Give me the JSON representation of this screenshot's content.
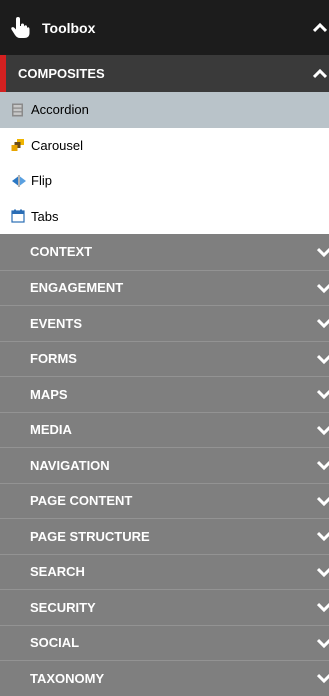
{
  "header": {
    "title": "Toolbox",
    "icon": "hand-pointer-icon"
  },
  "open_section": {
    "label": "COMPOSITES",
    "items": [
      {
        "label": "Accordion",
        "icon": "accordion-icon",
        "selected": true
      },
      {
        "label": "Carousel",
        "icon": "carousel-icon",
        "selected": false
      },
      {
        "label": "Flip",
        "icon": "flip-icon",
        "selected": false
      },
      {
        "label": "Tabs",
        "icon": "tabs-icon",
        "selected": false
      }
    ]
  },
  "sections": [
    {
      "label": "CONTEXT"
    },
    {
      "label": "ENGAGEMENT"
    },
    {
      "label": "EVENTS"
    },
    {
      "label": "FORMS"
    },
    {
      "label": "MAPS"
    },
    {
      "label": "MEDIA"
    },
    {
      "label": "NAVIGATION"
    },
    {
      "label": "PAGE CONTENT"
    },
    {
      "label": "PAGE STRUCTURE"
    },
    {
      "label": "SEARCH"
    },
    {
      "label": "SECURITY"
    },
    {
      "label": "SOCIAL"
    },
    {
      "label": "TAXONOMY"
    }
  ],
  "colors": {
    "header_bg": "#1c1c1c",
    "open_section_bg": "#3a3a3a",
    "active_marker": "#d32020",
    "selected_item_bg": "#b9c3c9",
    "section_bg": "#7f7f7f"
  }
}
